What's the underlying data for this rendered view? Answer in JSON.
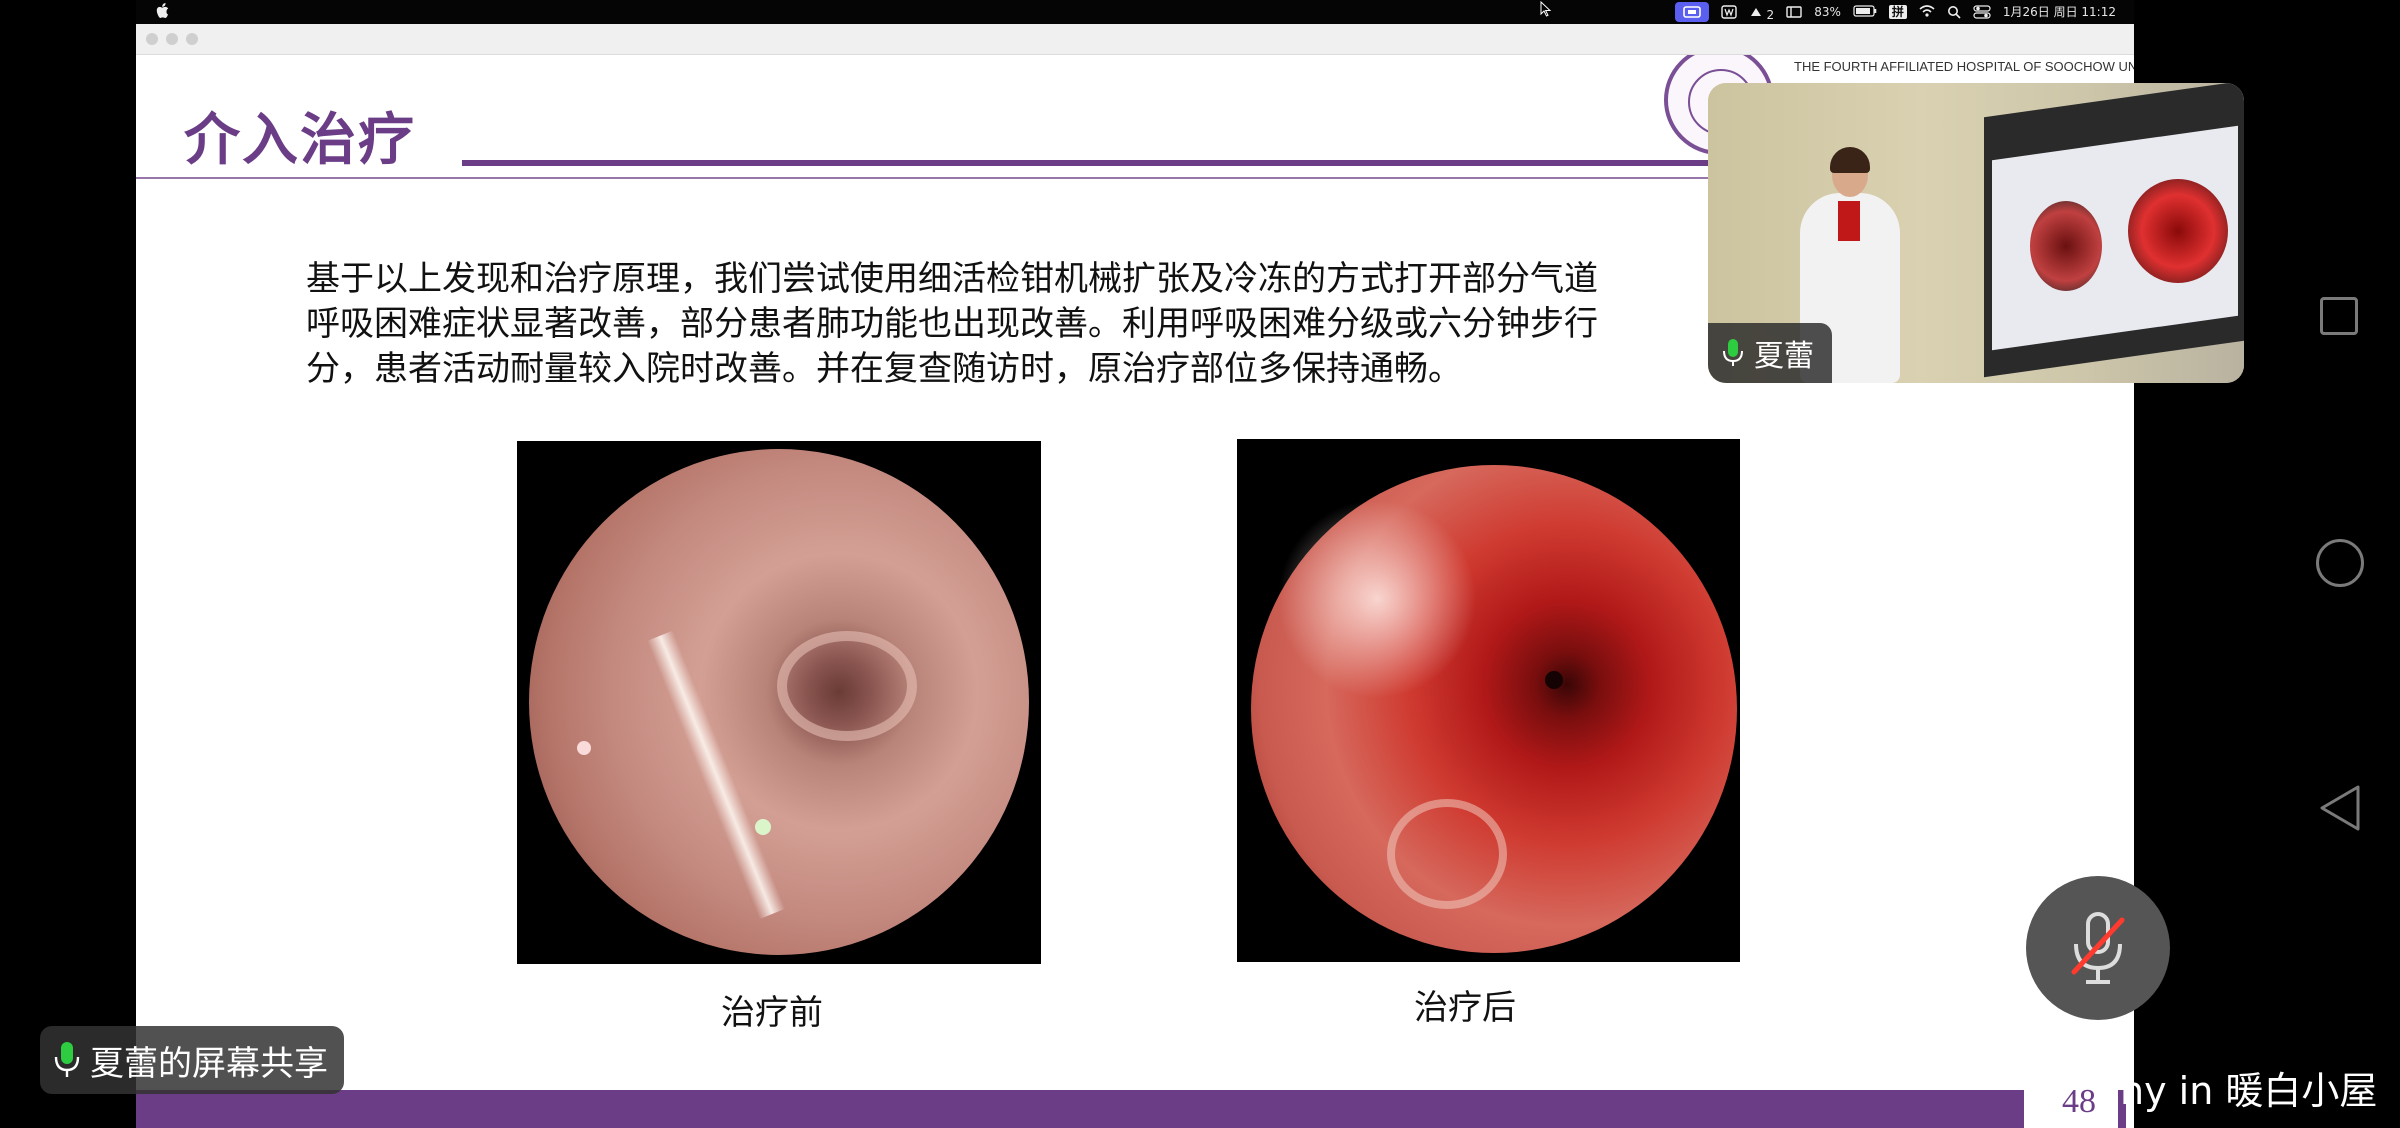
{
  "menubar": {
    "status_text": {
      "battery": "83%",
      "notif_count": "2",
      "input_method": "拼",
      "datetime": "1月26日 周日 11:12"
    }
  },
  "slide": {
    "title": "介入治疗",
    "header": {
      "hospital_en": "THE FOURTH AFFILIATED HOSPITAL OF SOOCHOW UNIVERSITY"
    },
    "body_lines": [
      "基于以上发现和治疗原理，我们尝试使用细活检钳机械扩张及冷冻的方式打开部分气道",
      "呼吸困难症状显著改善，部分患者肺功能也出现改善。利用呼吸困难分级或六分钟步行",
      "分，患者活动耐量较入院时改善。并在复查随访时，原治疗部位多保持通畅。"
    ],
    "image_left_caption": "治疗前",
    "image_right_caption": "治疗后",
    "page_number": "48"
  },
  "video": {
    "speaker_name": "夏蕾"
  },
  "screen_share": {
    "label": "夏蕾的屏幕共享"
  },
  "watermark": "ny in 暖白小屋",
  "colors": {
    "accent": "#6b3d86",
    "mic_green": "#2ecc40"
  }
}
